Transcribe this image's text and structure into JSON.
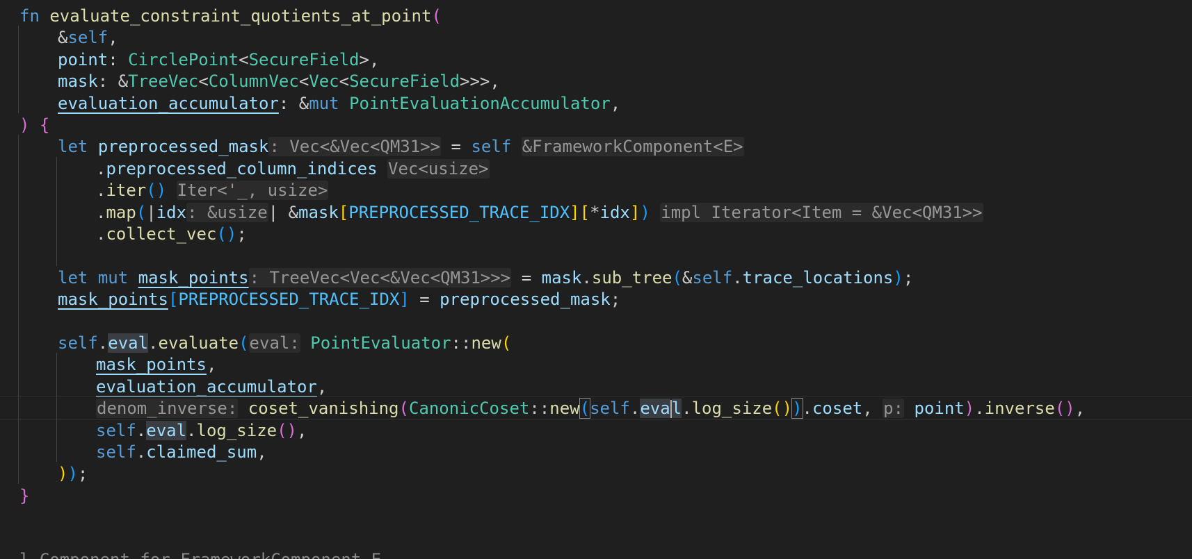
{
  "editor": {
    "language": "rust",
    "theme_colors": {
      "background": "#1f1f1f",
      "keyword": "#569cd6",
      "function": "#dcdcaa",
      "type": "#4ec9b0",
      "variable": "#9cdcfe",
      "constant": "#4fc1ff",
      "inlay_hint": "#969696"
    },
    "lines": [
      {
        "indent": 0,
        "tokens": [
          [
            "kw",
            "fn"
          ],
          [
            "p",
            " "
          ],
          [
            "fn",
            "evaluate_constraint_quotients_at_point"
          ],
          [
            "br2",
            "("
          ]
        ]
      },
      {
        "indent": 1,
        "tokens": [
          [
            "p",
            "&"
          ],
          [
            "kw",
            "self"
          ],
          [
            "p",
            ","
          ]
        ]
      },
      {
        "indent": 1,
        "tokens": [
          [
            "var",
            "point"
          ],
          [
            "p",
            ": "
          ],
          [
            "ty",
            "CirclePoint"
          ],
          [
            "p",
            "<"
          ],
          [
            "ty",
            "SecureField"
          ],
          [
            "p",
            ">,"
          ]
        ]
      },
      {
        "indent": 1,
        "tokens": [
          [
            "var",
            "mask"
          ],
          [
            "p",
            ": &"
          ],
          [
            "ty",
            "TreeVec"
          ],
          [
            "p",
            "<"
          ],
          [
            "ty",
            "ColumnVec"
          ],
          [
            "p",
            "<"
          ],
          [
            "ty",
            "Vec"
          ],
          [
            "p",
            "<"
          ],
          [
            "ty",
            "SecureField"
          ],
          [
            "p",
            ">>>,"
          ]
        ]
      },
      {
        "indent": 1,
        "tokens": [
          [
            "varu",
            "evaluation_accumulator"
          ],
          [
            "p",
            ": &"
          ],
          [
            "kw",
            "mut"
          ],
          [
            "p",
            " "
          ],
          [
            "ty",
            "PointEvaluationAccumulator"
          ],
          [
            "p",
            ","
          ]
        ]
      },
      {
        "indent": 0,
        "tokens": [
          [
            "br2",
            ")"
          ],
          [
            "p",
            " "
          ],
          [
            "br2",
            "{"
          ]
        ]
      },
      {
        "indent": 1,
        "tokens": [
          [
            "kw",
            "let"
          ],
          [
            "p",
            " "
          ],
          [
            "var",
            "preprocessed_mask"
          ],
          [
            "hint",
            ": Vec<&Vec<QM31>>"
          ],
          [
            "p",
            " = "
          ],
          [
            "kw",
            "self"
          ],
          [
            "p",
            " "
          ],
          [
            "hint",
            "&FrameworkComponent<E>"
          ]
        ]
      },
      {
        "indent": 2,
        "tokens": [
          [
            "p",
            "."
          ],
          [
            "var",
            "preprocessed_column_indices"
          ],
          [
            "p",
            " "
          ],
          [
            "hint",
            "Vec<usize>"
          ]
        ]
      },
      {
        "indent": 2,
        "tokens": [
          [
            "p",
            "."
          ],
          [
            "fn",
            "iter"
          ],
          [
            "br3",
            "()"
          ],
          [
            "p",
            " "
          ],
          [
            "hint",
            "Iter<'_, usize>"
          ]
        ]
      },
      {
        "indent": 2,
        "tokens": [
          [
            "p",
            "."
          ],
          [
            "fn",
            "map"
          ],
          [
            "br3",
            "("
          ],
          [
            "p",
            "|"
          ],
          [
            "var",
            "idx"
          ],
          [
            "hint",
            ": &usize"
          ],
          [
            "p",
            "| &"
          ],
          [
            "var",
            "mask"
          ],
          [
            "br1",
            "["
          ],
          [
            "const",
            "PREPROCESSED_TRACE_IDX"
          ],
          [
            "br1",
            "]["
          ],
          [
            "p",
            "*"
          ],
          [
            "var",
            "idx"
          ],
          [
            "br1",
            "]"
          ],
          [
            "br3",
            ")"
          ],
          [
            "p",
            " "
          ],
          [
            "hint",
            "impl Iterator<Item = &Vec<QM31>>"
          ]
        ]
      },
      {
        "indent": 2,
        "tokens": [
          [
            "p",
            "."
          ],
          [
            "fn",
            "collect_vec"
          ],
          [
            "br3",
            "()"
          ],
          [
            "p",
            ";"
          ]
        ]
      },
      {
        "indent": 1,
        "tokens": []
      },
      {
        "indent": 1,
        "tokens": [
          [
            "kw",
            "let"
          ],
          [
            "p",
            " "
          ],
          [
            "kw",
            "mut"
          ],
          [
            "p",
            " "
          ],
          [
            "varu",
            "mask_points"
          ],
          [
            "hint",
            ": TreeVec<Vec<&Vec<QM31>>>"
          ],
          [
            "p",
            " = "
          ],
          [
            "var",
            "mask"
          ],
          [
            "p",
            "."
          ],
          [
            "fn",
            "sub_tree"
          ],
          [
            "br3",
            "("
          ],
          [
            "p",
            "&"
          ],
          [
            "kw",
            "self"
          ],
          [
            "p",
            "."
          ],
          [
            "var",
            "trace_locations"
          ],
          [
            "br3",
            ")"
          ],
          [
            "p",
            ";"
          ]
        ]
      },
      {
        "indent": 1,
        "tokens": [
          [
            "varu",
            "mask_points"
          ],
          [
            "br3",
            "["
          ],
          [
            "const",
            "PREPROCESSED_TRACE_IDX"
          ],
          [
            "br3",
            "]"
          ],
          [
            "p",
            " = "
          ],
          [
            "var",
            "preprocessed_mask"
          ],
          [
            "p",
            ";"
          ]
        ]
      },
      {
        "indent": 0,
        "tokens": []
      },
      {
        "indent": 1,
        "tokens": [
          [
            "kw",
            "self"
          ],
          [
            "p",
            "."
          ],
          [
            "hl",
            "eval"
          ],
          [
            "p",
            "."
          ],
          [
            "fn",
            "evaluate"
          ],
          [
            "br3",
            "("
          ],
          [
            "hint",
            "eval:"
          ],
          [
            "p",
            " "
          ],
          [
            "ty",
            "PointEvaluator"
          ],
          [
            "p",
            "::"
          ],
          [
            "fn",
            "new"
          ],
          [
            "br1",
            "("
          ]
        ]
      },
      {
        "indent": 2,
        "tokens": [
          [
            "varu",
            "mask_points"
          ],
          [
            "p",
            ","
          ]
        ]
      },
      {
        "indent": 2,
        "tokens": [
          [
            "varu",
            "evaluation_accumulator"
          ],
          [
            "p",
            ","
          ]
        ]
      },
      {
        "indent": 2,
        "current": true,
        "tokens": [
          [
            "hint",
            "denom_inverse:"
          ],
          [
            "p",
            " "
          ],
          [
            "fn",
            "coset_vanishing"
          ],
          [
            "br2",
            "("
          ],
          [
            "ty",
            "CanonicCoset"
          ],
          [
            "p",
            "::"
          ],
          [
            "fn",
            "new"
          ],
          [
            "br3box",
            "("
          ],
          [
            "kw",
            "self"
          ],
          [
            "p",
            "."
          ],
          [
            "hl",
            "eva"
          ],
          [
            "cursor",
            ""
          ],
          [
            "hl",
            "l"
          ],
          [
            "p",
            "."
          ],
          [
            "fn",
            "log_size"
          ],
          [
            "br1",
            "()"
          ],
          [
            "br3box",
            ")"
          ],
          [
            "p",
            "."
          ],
          [
            "var",
            "coset"
          ],
          [
            "p",
            ", "
          ],
          [
            "hint",
            "p:"
          ],
          [
            "p",
            " "
          ],
          [
            "var",
            "point"
          ],
          [
            "br2",
            ")"
          ],
          [
            "p",
            "."
          ],
          [
            "fn",
            "inverse"
          ],
          [
            "br2",
            "()"
          ],
          [
            "p",
            ","
          ]
        ]
      },
      {
        "indent": 2,
        "tokens": [
          [
            "kw",
            "self"
          ],
          [
            "p",
            "."
          ],
          [
            "hl",
            "eval"
          ],
          [
            "p",
            "."
          ],
          [
            "fn",
            "log_size"
          ],
          [
            "br2",
            "()"
          ],
          [
            "p",
            ","
          ]
        ]
      },
      {
        "indent": 2,
        "tokens": [
          [
            "kw",
            "self"
          ],
          [
            "p",
            "."
          ],
          [
            "var",
            "claimed_sum"
          ],
          [
            "p",
            ","
          ]
        ]
      },
      {
        "indent": 1,
        "tokens": [
          [
            "br1",
            ")"
          ],
          [
            "br3",
            ")"
          ],
          [
            "p",
            ";"
          ]
        ]
      },
      {
        "indent": 0,
        "tokens": [
          [
            "br2",
            "}"
          ]
        ]
      }
    ],
    "partial_bottom_line": "l Component for FrameworkComponent E"
  }
}
